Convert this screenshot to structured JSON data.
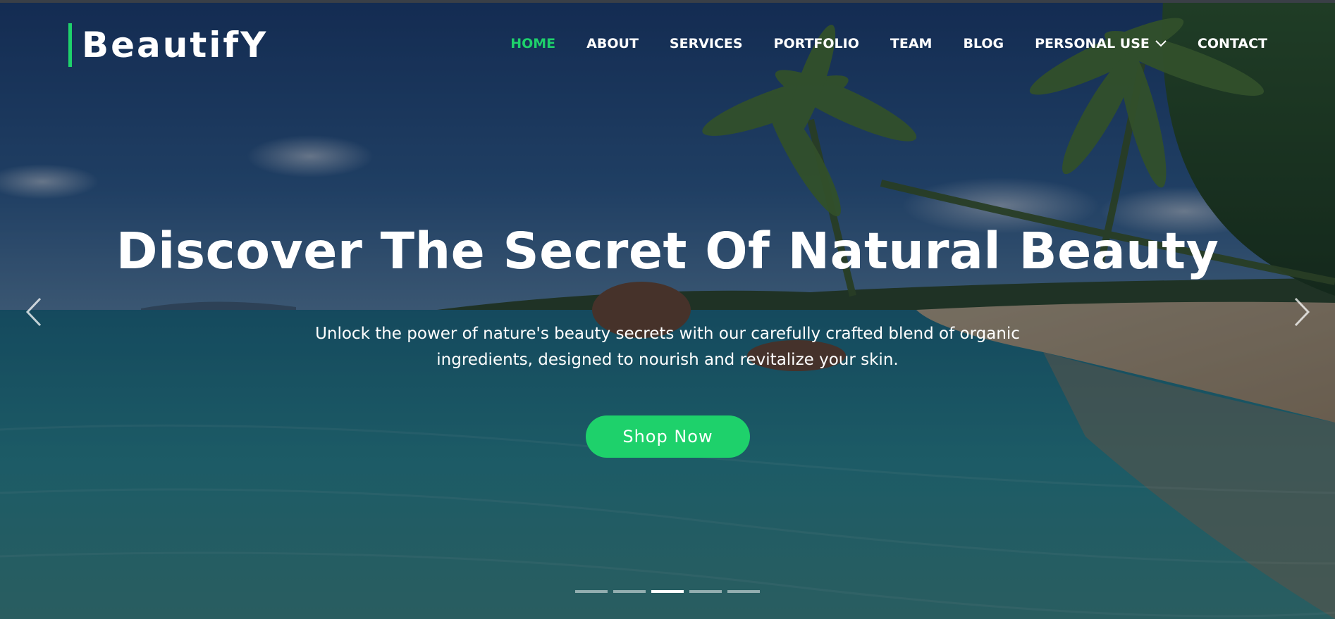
{
  "brand": {
    "name": "BeautifY",
    "accent_color": "#1ed16b"
  },
  "nav": {
    "items": [
      {
        "label": "HOME",
        "active": true
      },
      {
        "label": "ABOUT",
        "active": false
      },
      {
        "label": "SERVICES",
        "active": false
      },
      {
        "label": "PORTFOLIO",
        "active": false
      },
      {
        "label": "TEAM",
        "active": false
      },
      {
        "label": "BLOG",
        "active": false
      },
      {
        "label": "PERSONAL USE",
        "active": false,
        "has_dropdown": true,
        "icon": "chevron-down-icon"
      },
      {
        "label": "CONTACT",
        "active": false
      }
    ]
  },
  "hero": {
    "title": "Discover The Secret Of Natural Beauty",
    "subtitle": "Unlock the power of nature's beauty secrets with our carefully crafted blend of organic ingredients, designed to nourish and revitalize your skin.",
    "cta_label": "Shop Now",
    "prev_icon": "chevron-left-icon",
    "next_icon": "chevron-right-icon",
    "background": "tropical-beach-photo"
  },
  "carousel": {
    "slide_count": 5,
    "active_index": 2
  }
}
